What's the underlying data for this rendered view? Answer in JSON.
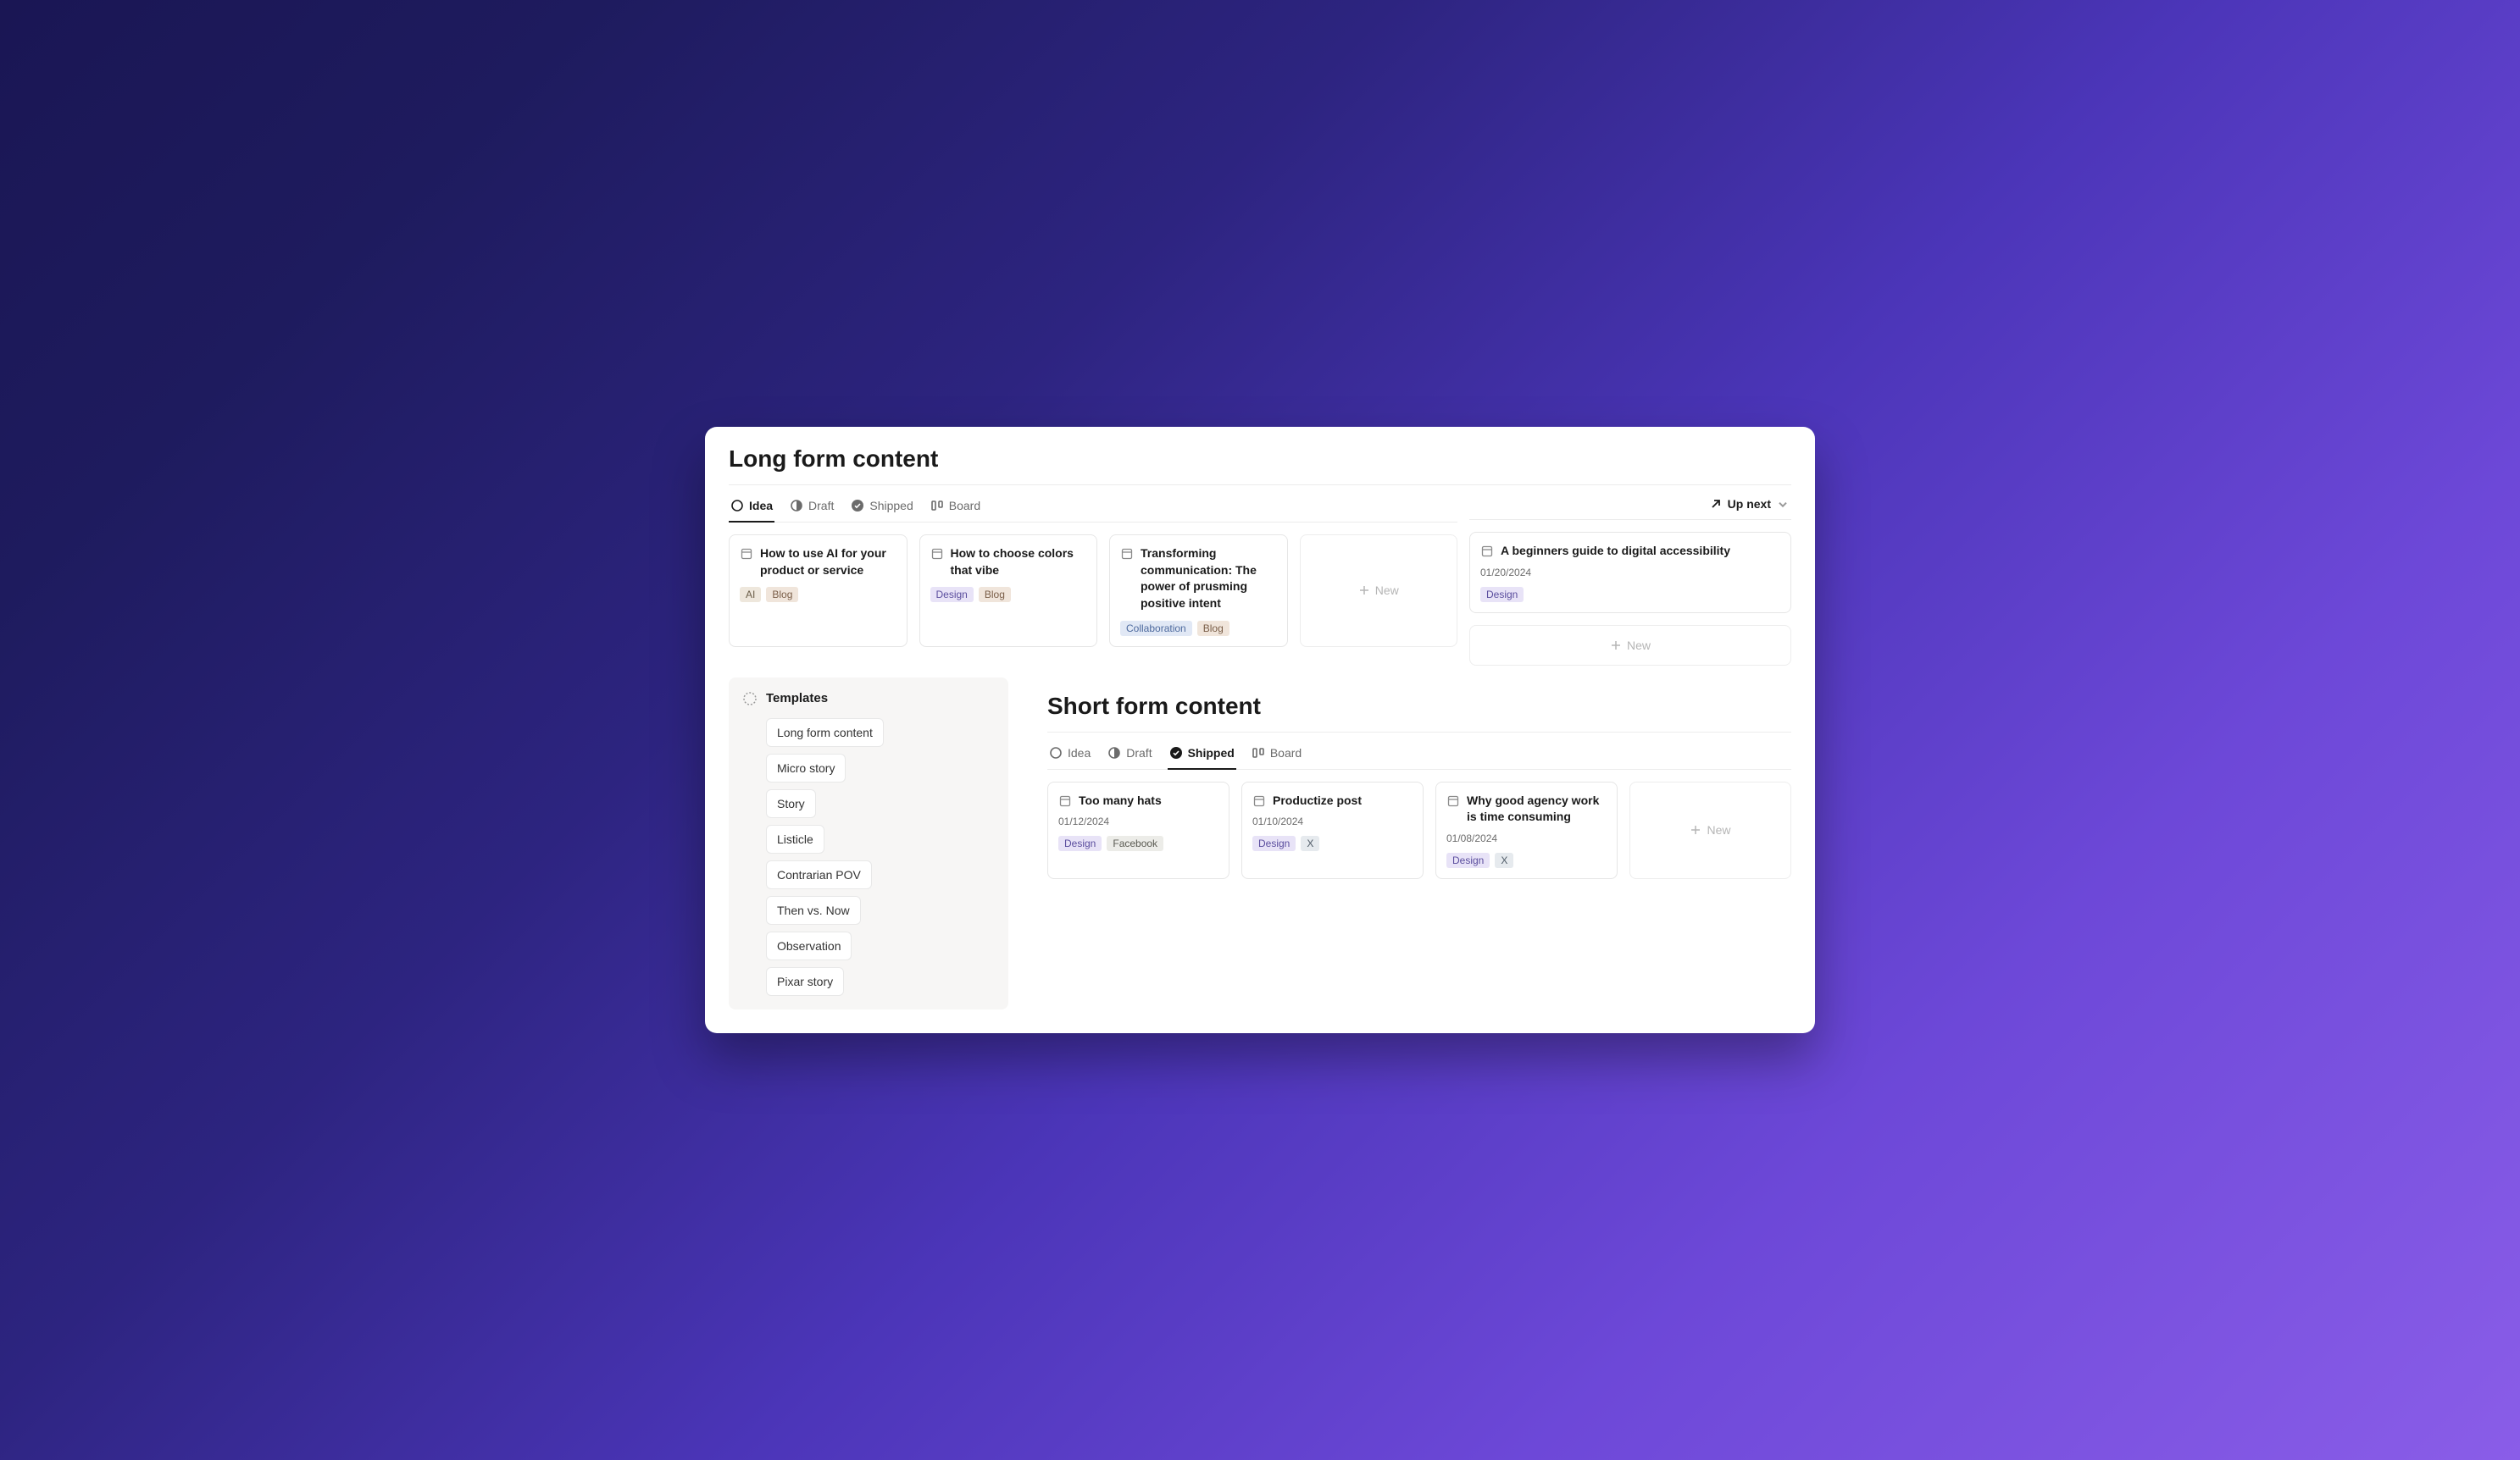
{
  "long_form": {
    "title": "Long form content",
    "tabs": {
      "idea": "Idea",
      "draft": "Draft",
      "shipped": "Shipped",
      "board": "Board"
    },
    "sort": "Up next",
    "cards": [
      {
        "title": "How to use AI for your product or service",
        "tags": [
          "AI",
          "Blog"
        ]
      },
      {
        "title": "How to choose colors that vibe",
        "tags": [
          "Design",
          "Blog"
        ]
      },
      {
        "title": "Transforming communication: The power of prusming positive intent",
        "tags": [
          "Collaboration",
          "Blog"
        ]
      }
    ],
    "new_label": "New",
    "up_next_cards": [
      {
        "title": "A beginners guide to digital accessibility",
        "date": "01/20/2024",
        "tags": [
          "Design"
        ]
      }
    ]
  },
  "templates": {
    "title": "Templates",
    "items": [
      "Long form content",
      "Micro story",
      "Story",
      "Listicle",
      "Contrarian POV",
      "Then vs. Now",
      "Observation",
      "Pixar story"
    ]
  },
  "short_form": {
    "title": "Short form content",
    "tabs": {
      "idea": "Idea",
      "draft": "Draft",
      "shipped": "Shipped",
      "board": "Board"
    },
    "cards": [
      {
        "title": "Too many hats",
        "date": "01/12/2024",
        "tags": [
          "Design",
          "Facebook"
        ]
      },
      {
        "title": "Productize post",
        "date": "01/10/2024",
        "tags": [
          "Design",
          "X"
        ]
      },
      {
        "title": "Why good agency work is time consuming",
        "date": "01/08/2024",
        "tags": [
          "Design",
          "X"
        ]
      }
    ],
    "new_label": "New"
  },
  "tag_styles": {
    "AI": "tag-ai",
    "Blog": "tag-blog",
    "Design": "tag-design",
    "Collaboration": "tag-collab",
    "Facebook": "tag-facebook",
    "X": "tag-x"
  }
}
